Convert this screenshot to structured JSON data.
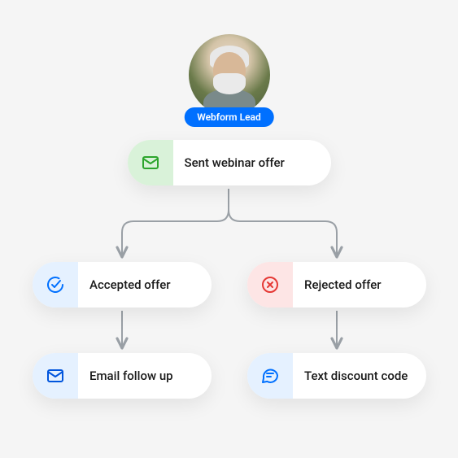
{
  "lead": {
    "badge": "Webform Lead"
  },
  "nodes": {
    "sent": {
      "label": "Sent webinar offer"
    },
    "accepted": {
      "label": "Accepted offer"
    },
    "rejected": {
      "label": "Rejected offer"
    },
    "email": {
      "label": "Email follow up"
    },
    "text": {
      "label": "Text discount code"
    }
  },
  "colors": {
    "badge": "#0070ff",
    "sentIcon": "#2ca52c",
    "sentBg": "#d9f2d9",
    "acceptedIcon": "#0070ff",
    "acceptedBg": "#e5f1ff",
    "rejectedIcon": "#e53935",
    "rejectedBg": "#fde5e5",
    "emailIcon": "#0055dd",
    "emailBg": "#e5f1ff",
    "textIcon": "#0070ff",
    "textBg": "#e5f1ff",
    "arrow": "#9aa0a6"
  }
}
